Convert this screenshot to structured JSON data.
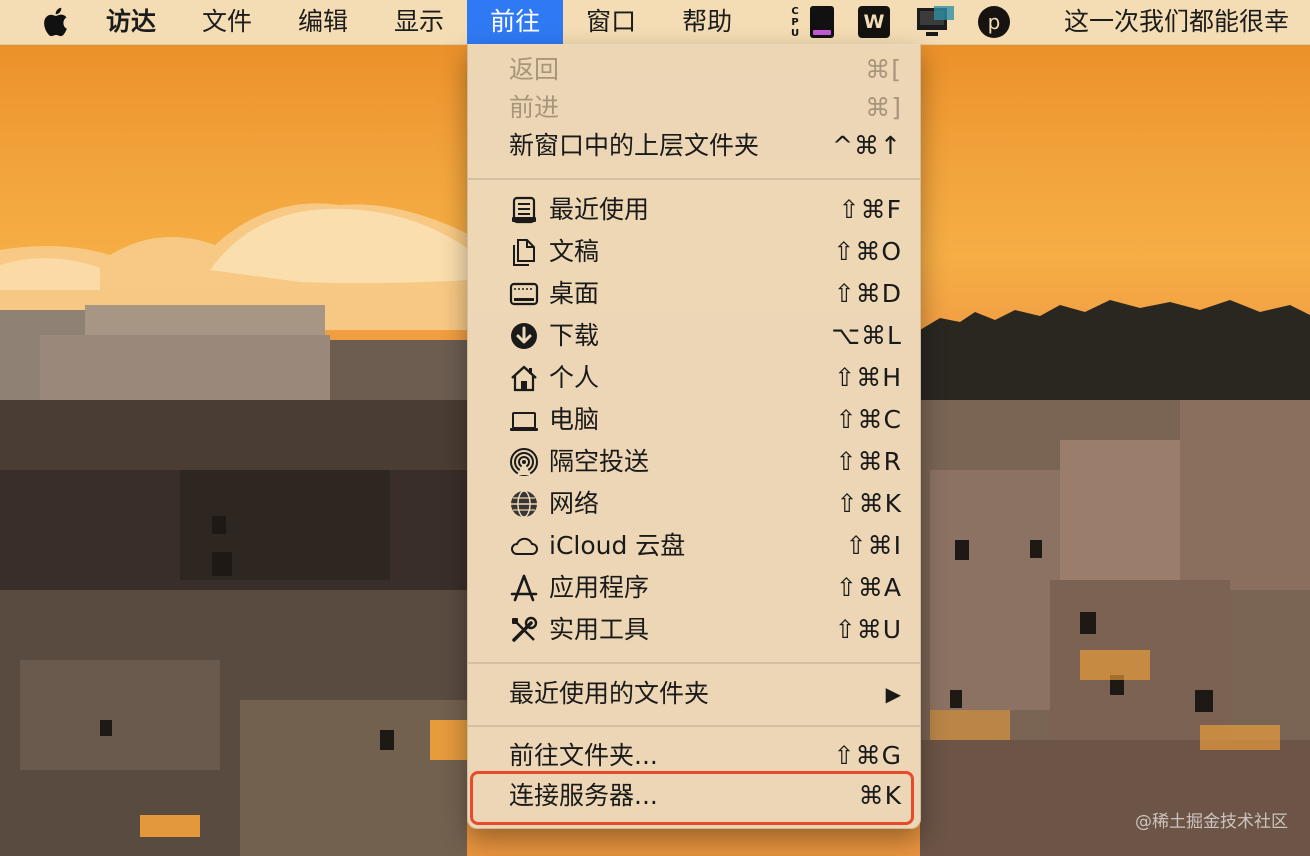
{
  "menubar": {
    "apple_icon": "apple-logo-icon",
    "app_name": "访达",
    "items": [
      "文件",
      "编辑",
      "显示",
      "前往",
      "窗口",
      "帮助"
    ],
    "active_item": "前往",
    "status": {
      "cpu_label": "CPU",
      "wps_label": "W",
      "p_label": "p",
      "now_playing": "这一次我们都能很幸"
    }
  },
  "go_menu": {
    "back": {
      "label": "返回",
      "shortcut": "⌘["
    },
    "forward": {
      "label": "前进",
      "shortcut": "⌘]"
    },
    "enclosing": {
      "label": "新窗口中的上层文件夹",
      "shortcut": "^⌘↑"
    },
    "places": [
      {
        "label": "最近使用",
        "shortcut": "⇧⌘F",
        "icon": "recents-icon"
      },
      {
        "label": "文稿",
        "shortcut": "⇧⌘O",
        "icon": "documents-icon"
      },
      {
        "label": "桌面",
        "shortcut": "⇧⌘D",
        "icon": "desktop-icon"
      },
      {
        "label": "下载",
        "shortcut": "⌥⌘L",
        "icon": "downloads-icon"
      },
      {
        "label": "个人",
        "shortcut": "⇧⌘H",
        "icon": "home-icon"
      },
      {
        "label": "电脑",
        "shortcut": "⇧⌘C",
        "icon": "computer-icon"
      },
      {
        "label": "隔空投送",
        "shortcut": "⇧⌘R",
        "icon": "airdrop-icon"
      },
      {
        "label": "网络",
        "shortcut": "⇧⌘K",
        "icon": "network-icon"
      },
      {
        "label": "iCloud 云盘",
        "shortcut": "⇧⌘I",
        "icon": "icloud-icon"
      },
      {
        "label": "应用程序",
        "shortcut": "⇧⌘A",
        "icon": "applications-icon"
      },
      {
        "label": "实用工具",
        "shortcut": "⇧⌘U",
        "icon": "utilities-icon"
      }
    ],
    "recent_folders": {
      "label": "最近使用的文件夹",
      "arrow": "▶"
    },
    "go_to_folder": {
      "label": "前往文件夹...",
      "shortcut": "⇧⌘G"
    },
    "connect_server": {
      "label": "连接服务器...",
      "shortcut": "⌘K"
    }
  },
  "watermark": "@稀土掘金技术社区",
  "colors": {
    "menubar_bg": "#f4ddb4",
    "active_menu_bg": "#2f7af4",
    "highlight_border": "#e94a2a"
  }
}
